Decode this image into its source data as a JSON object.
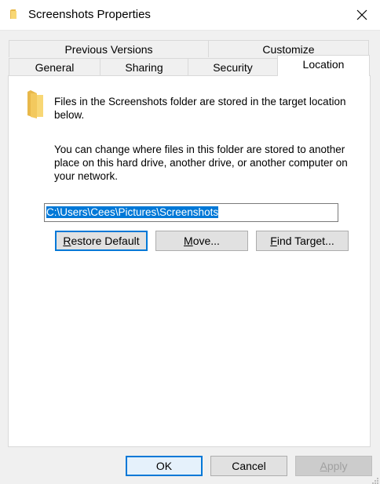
{
  "window": {
    "title": "Screenshots Properties"
  },
  "tabs": {
    "row1": [
      {
        "label": "Previous Versions"
      },
      {
        "label": "Customize"
      }
    ],
    "row2": [
      {
        "label": "General"
      },
      {
        "label": "Sharing"
      },
      {
        "label": "Security"
      },
      {
        "label": "Location",
        "selected": true
      }
    ]
  },
  "location": {
    "intro": "Files in the Screenshots folder are stored in the target location below.",
    "explanation": "You can change where files in this folder are stored to another place on this hard drive, another drive, or another computer on your network.",
    "path_value": "C:\\Users\\Cees\\Pictures\\Screenshots",
    "restore_prefix": "R",
    "restore_rest": "estore Default",
    "move_prefix": "M",
    "move_rest": "ove...",
    "find_prefix": "F",
    "find_rest": "ind Target..."
  },
  "footer": {
    "ok_label": "OK",
    "cancel_label": "Cancel",
    "apply_prefix": "A",
    "apply_rest": "pply"
  },
  "icons": {
    "title_icon": "folder-icon",
    "close_icon": "close-icon",
    "location_icon": "folder-icon",
    "folder_color": "#f8d775",
    "accent": "#0078d7"
  }
}
